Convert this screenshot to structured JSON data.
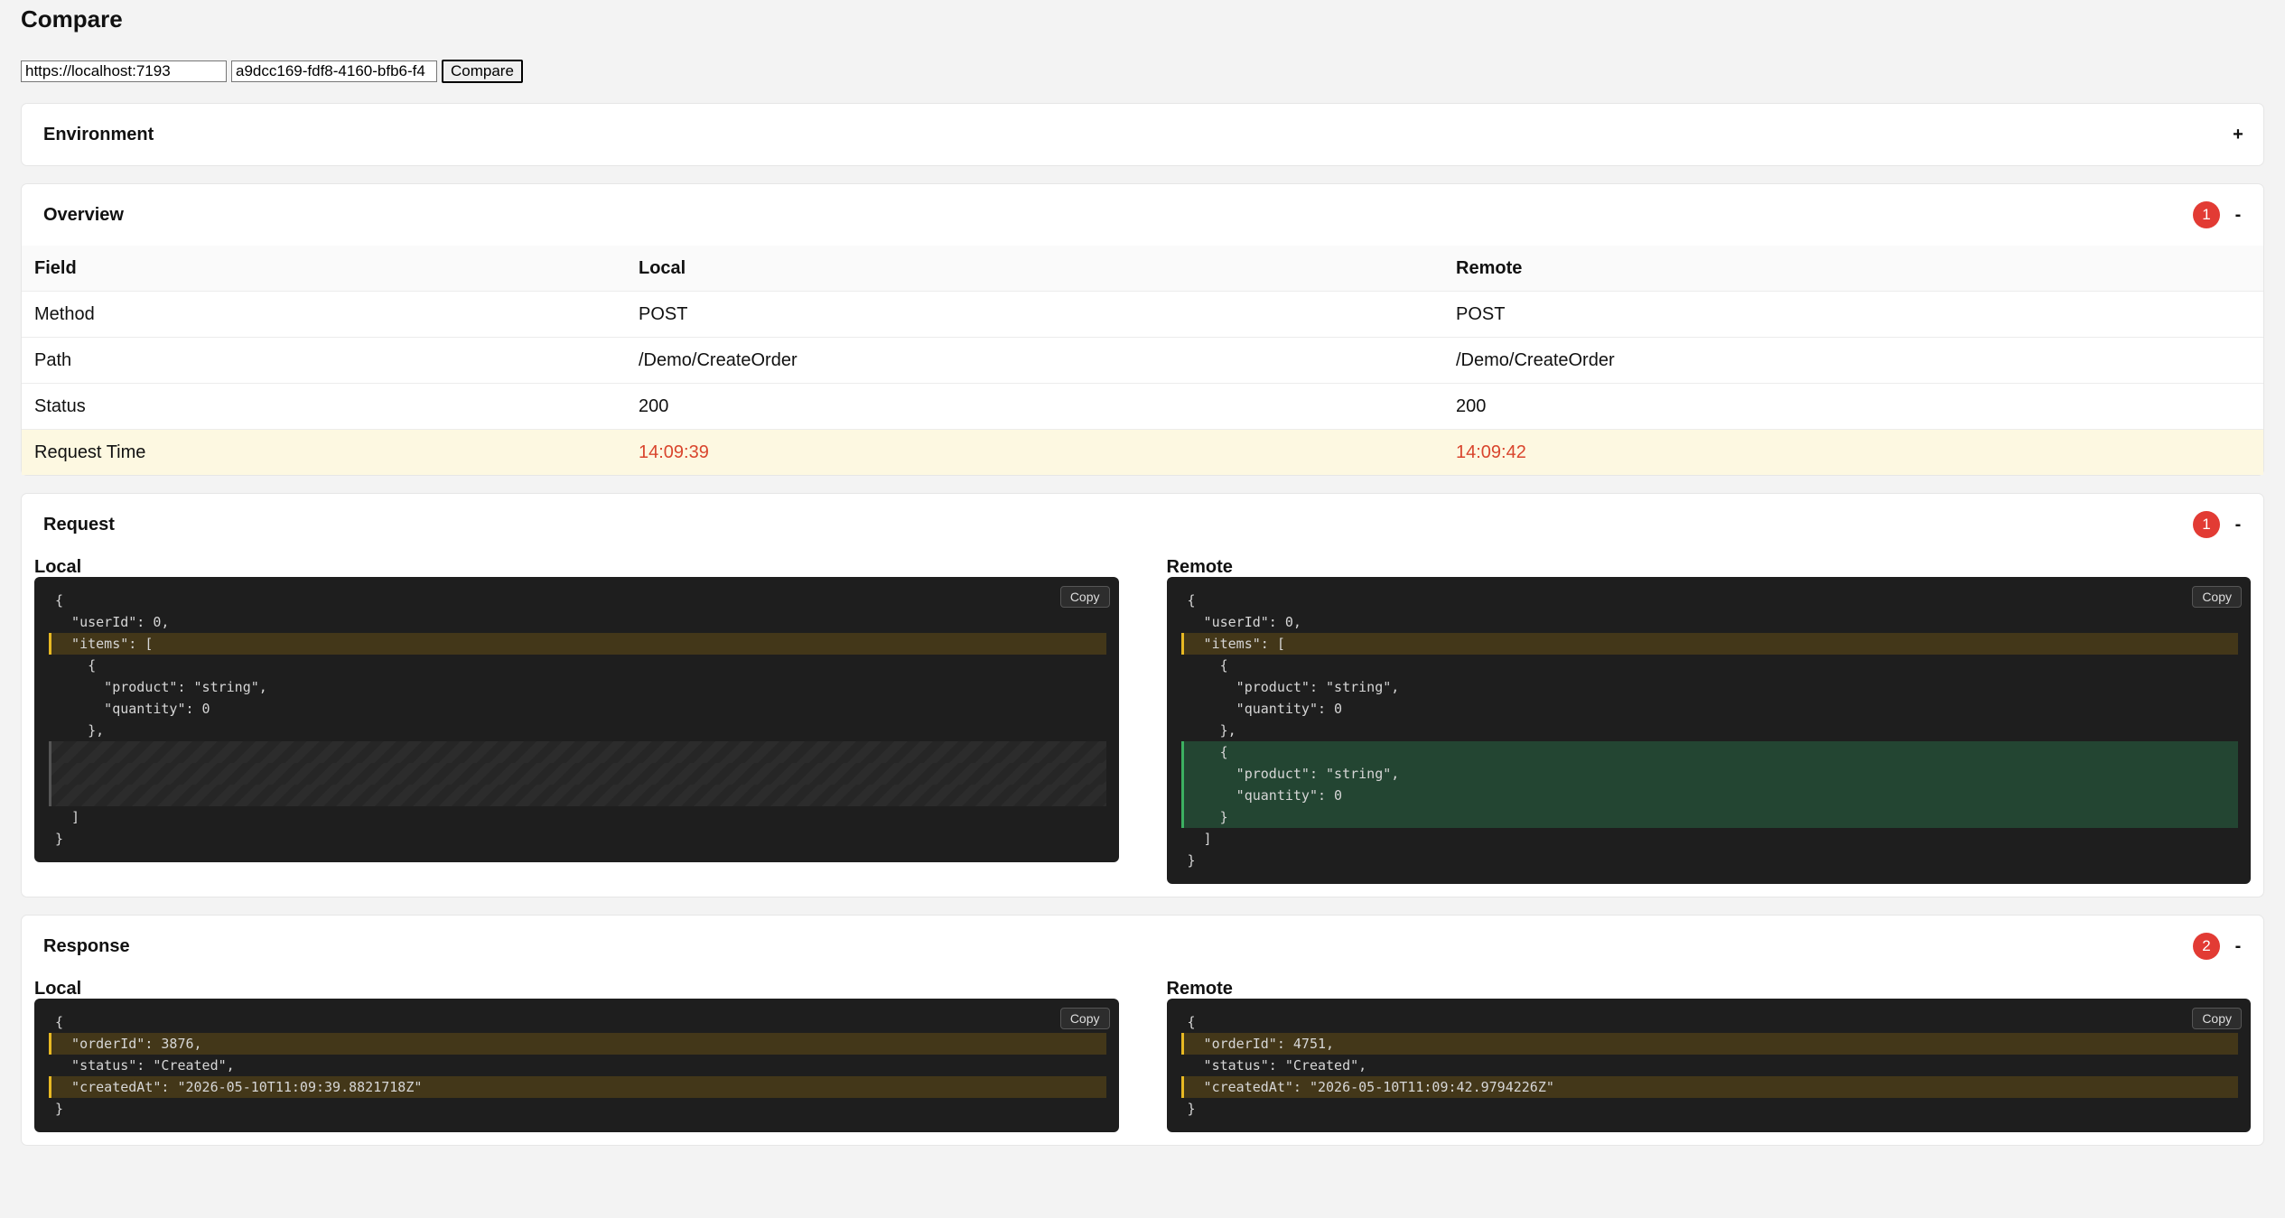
{
  "title": "Compare",
  "controls": {
    "base_url": "https://localhost:7193",
    "trace_id": "a9dcc169-fdf8-4160-bfb6-f4",
    "compare_label": "Compare"
  },
  "environment": {
    "title": "Environment",
    "toggle": "+"
  },
  "overview": {
    "title": "Overview",
    "badge": "1",
    "toggle": "-",
    "headers": {
      "field": "Field",
      "local": "Local",
      "remote": "Remote"
    },
    "rows": [
      {
        "field": "Method",
        "local": "POST",
        "remote": "POST"
      },
      {
        "field": "Path",
        "local": "/Demo/CreateOrder",
        "remote": "/Demo/CreateOrder"
      },
      {
        "field": "Status",
        "local": "200",
        "remote": "200"
      },
      {
        "field": "Request Time",
        "local": "14:09:39",
        "remote": "14:09:42"
      }
    ]
  },
  "request": {
    "title": "Request",
    "badge": "1",
    "toggle": "-",
    "local_label": "Local",
    "remote_label": "Remote",
    "copy_label": "Copy",
    "local_lines": [
      {
        "text": "{",
        "kind": ""
      },
      {
        "text": "  \"userId\": 0,",
        "kind": ""
      },
      {
        "text": "  \"items\": [",
        "kind": "chg"
      },
      {
        "text": "    {",
        "kind": ""
      },
      {
        "text": "      \"product\": \"string\",",
        "kind": ""
      },
      {
        "text": "      \"quantity\": 0",
        "kind": ""
      },
      {
        "text": "    },",
        "kind": ""
      },
      {
        "text": "",
        "kind": "gap"
      },
      {
        "text": "",
        "kind": "gap"
      },
      {
        "text": "",
        "kind": "gap"
      },
      {
        "text": "  ]",
        "kind": ""
      },
      {
        "text": "}",
        "kind": ""
      }
    ],
    "remote_lines": [
      {
        "text": "{",
        "kind": ""
      },
      {
        "text": "  \"userId\": 0,",
        "kind": ""
      },
      {
        "text": "  \"items\": [",
        "kind": "chg"
      },
      {
        "text": "    {",
        "kind": ""
      },
      {
        "text": "      \"product\": \"string\",",
        "kind": ""
      },
      {
        "text": "      \"quantity\": 0",
        "kind": ""
      },
      {
        "text": "    },",
        "kind": ""
      },
      {
        "text": "    {",
        "kind": "add"
      },
      {
        "text": "      \"product\": \"string\",",
        "kind": "add"
      },
      {
        "text": "      \"quantity\": 0",
        "kind": "add"
      },
      {
        "text": "    }",
        "kind": "add"
      },
      {
        "text": "  ]",
        "kind": ""
      },
      {
        "text": "}",
        "kind": ""
      }
    ]
  },
  "response": {
    "title": "Response",
    "badge": "2",
    "toggle": "-",
    "local_label": "Local",
    "remote_label": "Remote",
    "copy_label": "Copy",
    "local_lines": [
      {
        "text": "{",
        "kind": ""
      },
      {
        "text": "  \"orderId\": 3876,",
        "kind": "chg"
      },
      {
        "text": "  \"status\": \"Created\",",
        "kind": ""
      },
      {
        "text": "  \"createdAt\": \"2026-05-10T11:09:39.8821718Z\"",
        "kind": "chg"
      },
      {
        "text": "}",
        "kind": ""
      }
    ],
    "remote_lines": [
      {
        "text": "{",
        "kind": ""
      },
      {
        "text": "  \"orderId\": 4751,",
        "kind": "chg"
      },
      {
        "text": "  \"status\": \"Created\",",
        "kind": ""
      },
      {
        "text": "  \"createdAt\": \"2026-05-10T11:09:42.9794226Z\"",
        "kind": "chg"
      },
      {
        "text": "}",
        "kind": ""
      }
    ]
  },
  "colors": {
    "badge": "#e23b34",
    "diff_text": "#d9452d",
    "changed": "#e8b923",
    "added": "#3cb061"
  }
}
